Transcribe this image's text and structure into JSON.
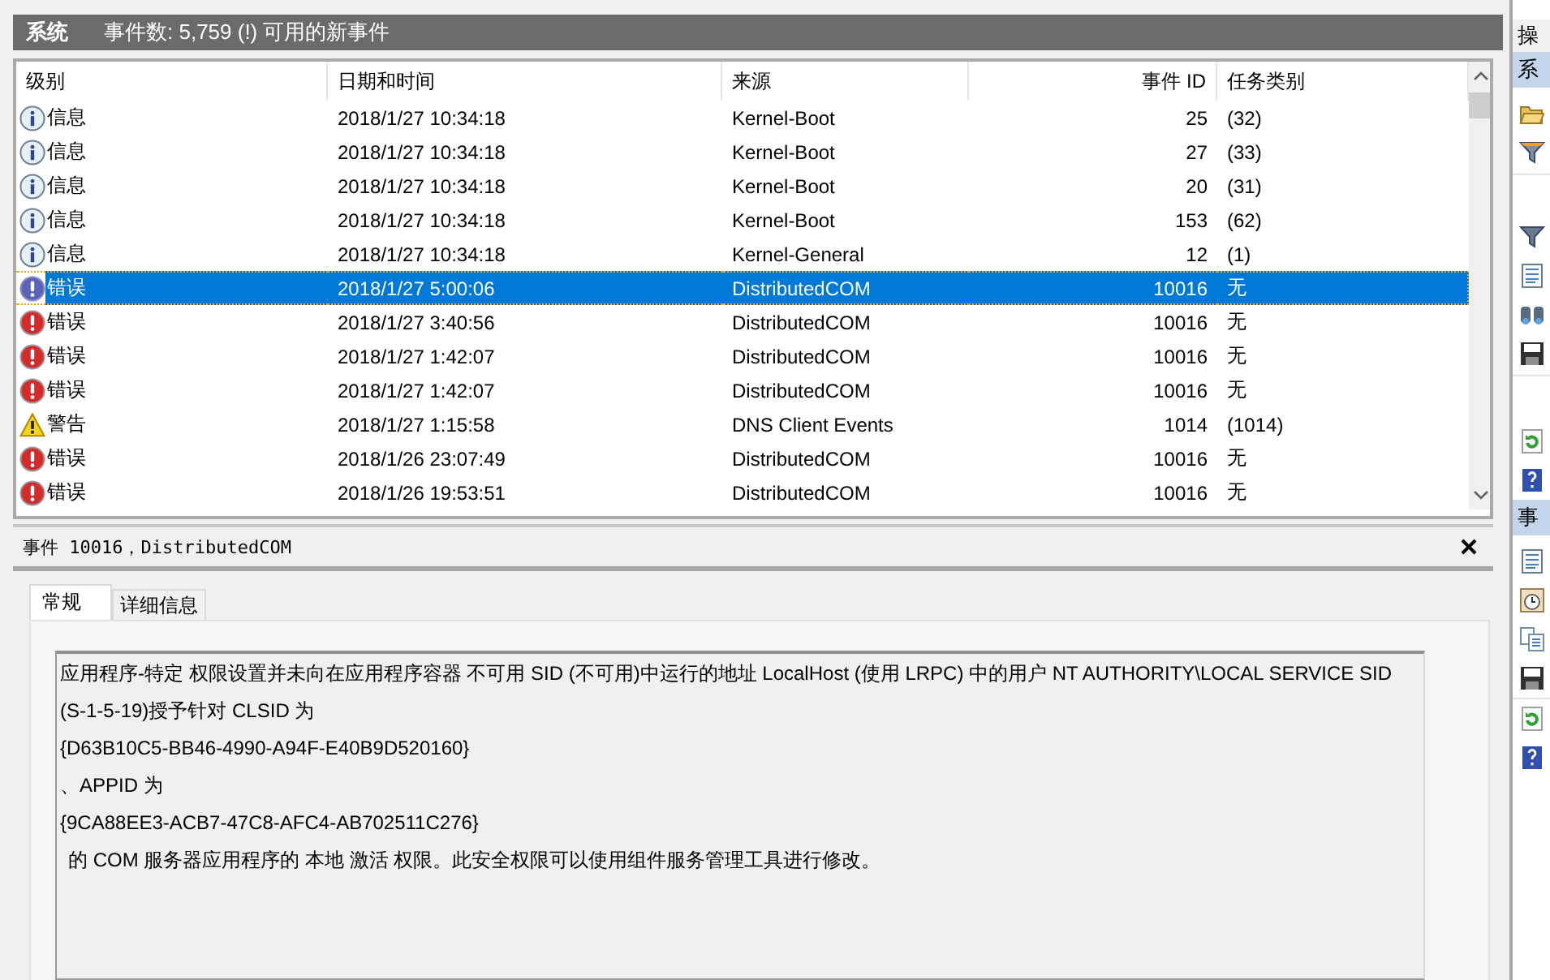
{
  "header": {
    "title": "系统",
    "summary": "事件数: 5,759 (!) 可用的新事件"
  },
  "table": {
    "columns": [
      "级别",
      "日期和时间",
      "来源",
      "事件 ID",
      "任务类别"
    ],
    "rows": [
      {
        "kind": "info",
        "level": "信息",
        "date": "2018/1/27 10:34:18",
        "source": "Kernel-Boot",
        "event_id": "25",
        "task": "(32)",
        "selected": false
      },
      {
        "kind": "info",
        "level": "信息",
        "date": "2018/1/27 10:34:18",
        "source": "Kernel-Boot",
        "event_id": "27",
        "task": "(33)",
        "selected": false
      },
      {
        "kind": "info",
        "level": "信息",
        "date": "2018/1/27 10:34:18",
        "source": "Kernel-Boot",
        "event_id": "20",
        "task": "(31)",
        "selected": false
      },
      {
        "kind": "info",
        "level": "信息",
        "date": "2018/1/27 10:34:18",
        "source": "Kernel-Boot",
        "event_id": "153",
        "task": "(62)",
        "selected": false
      },
      {
        "kind": "info",
        "level": "信息",
        "date": "2018/1/27 10:34:18",
        "source": "Kernel-General",
        "event_id": "12",
        "task": "(1)",
        "selected": false
      },
      {
        "kind": "error",
        "level": "错误",
        "date": "2018/1/27 5:00:06",
        "source": "DistributedCOM",
        "event_id": "10016",
        "task": "无",
        "selected": true
      },
      {
        "kind": "error",
        "level": "错误",
        "date": "2018/1/27 3:40:56",
        "source": "DistributedCOM",
        "event_id": "10016",
        "task": "无",
        "selected": false
      },
      {
        "kind": "error",
        "level": "错误",
        "date": "2018/1/27 1:42:07",
        "source": "DistributedCOM",
        "event_id": "10016",
        "task": "无",
        "selected": false
      },
      {
        "kind": "error",
        "level": "错误",
        "date": "2018/1/27 1:42:07",
        "source": "DistributedCOM",
        "event_id": "10016",
        "task": "无",
        "selected": false
      },
      {
        "kind": "warning",
        "level": "警告",
        "date": "2018/1/27 1:15:58",
        "source": "DNS Client Events",
        "event_id": "1014",
        "task": "(1014)",
        "selected": false
      },
      {
        "kind": "error",
        "level": "错误",
        "date": "2018/1/26 23:07:49",
        "source": "DistributedCOM",
        "event_id": "10016",
        "task": "无",
        "selected": false
      },
      {
        "kind": "error",
        "level": "错误",
        "date": "2018/1/26 19:53:51",
        "source": "DistributedCOM",
        "event_id": "10016",
        "task": "无",
        "selected": false
      }
    ]
  },
  "detail": {
    "title": "事件 10016，DistributedCOM",
    "tabs": [
      {
        "label": "常规",
        "selected": true
      },
      {
        "label": "详细信息",
        "selected": false
      }
    ],
    "message": [
      "应用程序-特定 权限设置并未向在应用程序容器 不可用 SID (不可用)中运行的地址 LocalHost (使用 LRPC) 中的用户 NT AUTHORITY\\LOCAL SERVICE SID",
      "(S-1-5-19)授予针对 CLSID 为",
      "{D63B10C5-BB46-4990-A94F-E40B9D520160}",
      "、APPID 为",
      "{9CA88EE3-ACB7-47C8-AFC4-AB702511C276}",
      "的 COM 服务器应用程序的 本地 激活 权限。此安全权限可以使用组件服务管理工具进行修改。"
    ]
  },
  "actions": {
    "title": "操",
    "section_1": "系",
    "section_2": "事"
  }
}
